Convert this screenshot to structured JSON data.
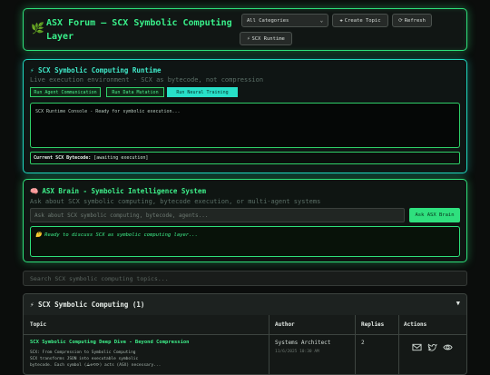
{
  "header": {
    "title": "ASX Forum — SCX Symbolic Computing Layer",
    "category_select": "All Categories",
    "create_label": "Create Topic",
    "refresh_label": "Refresh",
    "runtime_label": "SCX Runtime",
    "accent": "#2ee07a"
  },
  "runtime": {
    "title": "⚡ SCX Symbolic Computing Runtime",
    "subtitle": "Live execution environment - SCX as bytecode, not compression",
    "buttons": [
      "Run Agent Communication",
      "Run Data Mutation",
      "Run Neural Training"
    ],
    "console_text": "SCX Runtime Console - Ready for symbolic execution...",
    "bytecode_label": "Current SCX Bytecode:",
    "bytecode_value": "[awaiting execution]",
    "accent": "#1fd8c0"
  },
  "brain": {
    "title": "ASX Brain - Symbolic Intelligence System",
    "subtitle": "Ask about SCX symbolic computing, bytecode execution, or multi-agent systems",
    "input_placeholder": "Ask about SCX symbolic computing, bytecode, agents...",
    "ask_label": "Ask ASX Brain",
    "output_text": "Ready to discuss SCX as symbolic computing layer..."
  },
  "search": {
    "placeholder": "Search SCX symbolic computing topics..."
  },
  "topics": {
    "section_title": "⚡ SCX Symbolic Computing (1)",
    "toggle": "▼",
    "columns": [
      "Topic",
      "Author",
      "Replies",
      "Actions"
    ],
    "rows": [
      {
        "title": "SCX Symbolic Computing Deep Dive - Beyond Compression",
        "desc_lines": [
          "SCX: From Compression to Symbolic Computing",
          "SCX transforms JSON into executable symbolic",
          "bytecode. Each symbol (⟁⊕⟲⟳) acts (ASX) necessary..."
        ],
        "author": "Systems Architect",
        "time": "11/6/2025 10:30 AM",
        "replies": "2",
        "actions": [
          "mail-icon",
          "twitter-icon",
          "eye-icon"
        ]
      }
    ]
  }
}
